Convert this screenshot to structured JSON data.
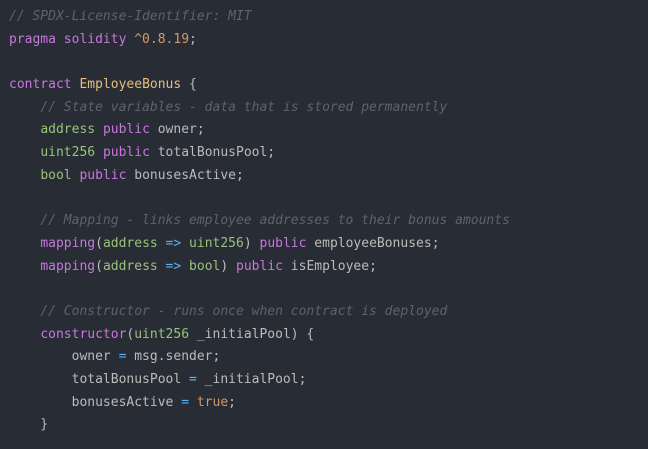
{
  "code": {
    "lines": [
      [
        {
          "t": "// SPDX-License-Identifier: MIT",
          "c": "comment"
        }
      ],
      [
        {
          "t": "pragma solidity ",
          "c": "kw"
        },
        {
          "t": "^0.8.19",
          "c": "num"
        },
        {
          "t": ";",
          "c": "punc"
        }
      ],
      [],
      [
        {
          "t": "contract ",
          "c": "kw"
        },
        {
          "t": "EmployeeBonus",
          "c": "cls"
        },
        {
          "t": " {",
          "c": "punc"
        }
      ],
      [
        {
          "t": "    ",
          "c": "punc"
        },
        {
          "t": "// State variables - data that is stored permanently",
          "c": "comment"
        }
      ],
      [
        {
          "t": "    ",
          "c": "punc"
        },
        {
          "t": "address",
          "c": "type"
        },
        {
          "t": " ",
          "c": "punc"
        },
        {
          "t": "public",
          "c": "kw"
        },
        {
          "t": " owner;",
          "c": "ident"
        }
      ],
      [
        {
          "t": "    ",
          "c": "punc"
        },
        {
          "t": "uint256",
          "c": "type"
        },
        {
          "t": " ",
          "c": "punc"
        },
        {
          "t": "public",
          "c": "kw"
        },
        {
          "t": " totalBonusPool;",
          "c": "ident"
        }
      ],
      [
        {
          "t": "    ",
          "c": "punc"
        },
        {
          "t": "bool",
          "c": "type"
        },
        {
          "t": " ",
          "c": "punc"
        },
        {
          "t": "public",
          "c": "kw"
        },
        {
          "t": " bonusesActive;",
          "c": "ident"
        }
      ],
      [],
      [
        {
          "t": "    ",
          "c": "punc"
        },
        {
          "t": "// Mapping - links employee addresses to their bonus amounts",
          "c": "comment"
        }
      ],
      [
        {
          "t": "    ",
          "c": "punc"
        },
        {
          "t": "mapping",
          "c": "kw"
        },
        {
          "t": "(",
          "c": "punc"
        },
        {
          "t": "address",
          "c": "type"
        },
        {
          "t": " => ",
          "c": "op"
        },
        {
          "t": "uint256",
          "c": "type"
        },
        {
          "t": ") ",
          "c": "punc"
        },
        {
          "t": "public",
          "c": "kw"
        },
        {
          "t": " employeeBonuses;",
          "c": "ident"
        }
      ],
      [
        {
          "t": "    ",
          "c": "punc"
        },
        {
          "t": "mapping",
          "c": "kw"
        },
        {
          "t": "(",
          "c": "punc"
        },
        {
          "t": "address",
          "c": "type"
        },
        {
          "t": " => ",
          "c": "op"
        },
        {
          "t": "bool",
          "c": "type"
        },
        {
          "t": ") ",
          "c": "punc"
        },
        {
          "t": "public",
          "c": "kw"
        },
        {
          "t": " isEmployee;",
          "c": "ident"
        }
      ],
      [],
      [
        {
          "t": "    ",
          "c": "punc"
        },
        {
          "t": "// Constructor - runs once when contract is deployed",
          "c": "comment"
        }
      ],
      [
        {
          "t": "    ",
          "c": "punc"
        },
        {
          "t": "constructor",
          "c": "fn"
        },
        {
          "t": "(",
          "c": "punc"
        },
        {
          "t": "uint256",
          "c": "type"
        },
        {
          "t": " _initialPool) {",
          "c": "ident"
        }
      ],
      [
        {
          "t": "        owner ",
          "c": "ident"
        },
        {
          "t": "=",
          "c": "op"
        },
        {
          "t": " msg.sender;",
          "c": "ident"
        }
      ],
      [
        {
          "t": "        totalBonusPool ",
          "c": "ident"
        },
        {
          "t": "=",
          "c": "op"
        },
        {
          "t": " _initialPool;",
          "c": "ident"
        }
      ],
      [
        {
          "t": "        bonusesActive ",
          "c": "ident"
        },
        {
          "t": "=",
          "c": "op"
        },
        {
          "t": " ",
          "c": "punc"
        },
        {
          "t": "true",
          "c": "lit"
        },
        {
          "t": ";",
          "c": "punc"
        }
      ],
      [
        {
          "t": "    }",
          "c": "punc"
        }
      ]
    ]
  },
  "colors": {
    "background": "#282c34",
    "comment": "#5c6370",
    "keyword": "#c678dd",
    "type": "#98c379",
    "identifier": "#bbbbbb",
    "number": "#d19a66",
    "contract_name": "#e5c07b",
    "operator": "#61afef"
  }
}
